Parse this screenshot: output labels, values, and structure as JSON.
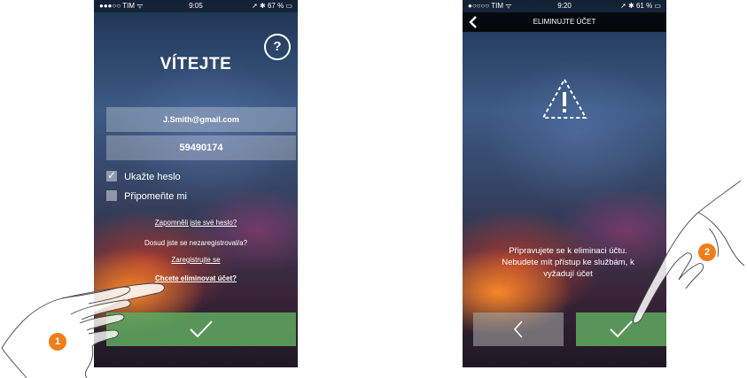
{
  "screen1": {
    "status": {
      "carrier": "●●●○○ TIM ᯤ",
      "time": "9:05",
      "battery": "➚ ✱ 67 % ▭"
    },
    "help_label": "?",
    "title": "VÍTEJTE",
    "email_value": "J.Smith@gmail.com",
    "password_value": "59490174",
    "show_password_label": "Ukažte heslo",
    "remember_label": "Připomeňte mi",
    "forgot_link": "Zapomněli jste své heslo?",
    "not_registered": "Dosud jste se nezaregistroval/a?",
    "register_link": "Zaregistrujte se",
    "delete_link": "Chcete eliminovat účet?"
  },
  "screen2": {
    "status": {
      "carrier": "●○○○○ TIM ᯤ",
      "time": "9:20",
      "battery": "➚ ✱ 61 % ▭"
    },
    "nav_title": "ELIMINUJTE ÚČET",
    "warning_line1": "Připravujete se k eliminaci účtu.",
    "warning_line2": "Nebudete mít přístup ke službám, k",
    "warning_line3": "vyžadují účet"
  },
  "callouts": {
    "one": "1",
    "two": "2"
  }
}
